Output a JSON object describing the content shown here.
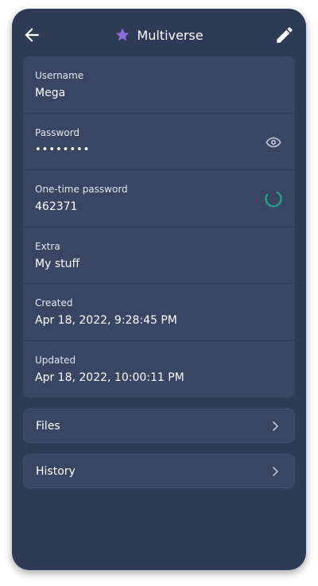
{
  "header": {
    "title": "Multiverse",
    "star_color": "#8b6ed6",
    "icons": {
      "back": "arrow-left-icon",
      "edit": "pencil-icon",
      "favorite": "star-icon"
    }
  },
  "fields": [
    {
      "label": "Username",
      "value": "Mega"
    },
    {
      "label": "Password",
      "value": "••••••••",
      "action_icon": "eye-icon"
    },
    {
      "label": "One-time password",
      "value": "462371",
      "action_icon": "timer-progress-icon",
      "timer_color": "#1fa187"
    },
    {
      "label": "Extra",
      "value": "My stuff"
    },
    {
      "label": "Created",
      "value": "Apr 18, 2022, 9:28:45 PM"
    },
    {
      "label": "Updated",
      "value": "Apr 18, 2022, 10:00:11 PM"
    }
  ],
  "nav": [
    {
      "label": "Files",
      "icon": "chevron-right-icon"
    },
    {
      "label": "History",
      "icon": "chevron-right-icon"
    }
  ],
  "colors": {
    "background": "#2f3a56",
    "card": "#3a4563",
    "accent_star": "#8b6ed6",
    "otp_timer": "#1fa187"
  }
}
